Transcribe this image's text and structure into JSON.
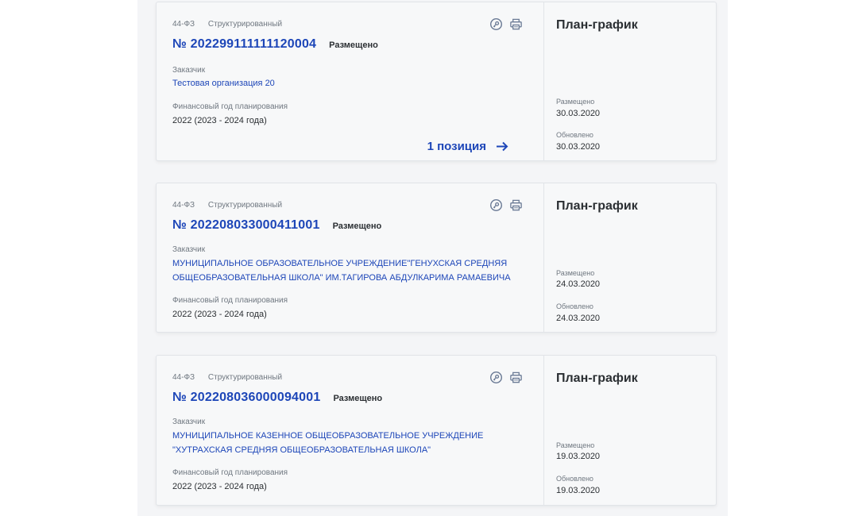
{
  "cards": [
    {
      "law": "44-ФЗ",
      "kind": "Структурированный",
      "number": "№ 202299111111120004",
      "status": "Размещено",
      "customer_label": "Заказчик",
      "customer_line1": "Тестовая организация 20",
      "customer_line2": "",
      "fin_year_label": "Финансовый год планирования",
      "fin_year": "2022 (2023 - 2024 года)",
      "positions_link": "1 позиция",
      "doc_type": "План-график",
      "placed_label": "Размещено",
      "placed_date": "30.03.2020",
      "updated_label": "Обновлено",
      "updated_date": "30.03.2020"
    },
    {
      "law": "44-ФЗ",
      "kind": "Структурированный",
      "number": "№ 202208033000411001",
      "status": "Размещено",
      "customer_label": "Заказчик",
      "customer_line1": "МУНИЦИПАЛЬНОЕ ОБРАЗОВАТЕЛЬНОЕ УЧРЕЖДЕНИЕ\"ГЕНУХСКАЯ СРЕДНЯЯ",
      "customer_line2": "ОБЩЕОБРАЗОВАТЕЛЬНАЯ ШКОЛА\" ИМ.ТАГИРОВА АБДУЛКАРИМА РАМАЕВИЧА",
      "fin_year_label": "Финансовый год планирования",
      "fin_year": "2022 (2023 - 2024 года)",
      "doc_type": "План-график",
      "placed_label": "Размещено",
      "placed_date": "24.03.2020",
      "updated_label": "Обновлено",
      "updated_date": "24.03.2020"
    },
    {
      "law": "44-ФЗ",
      "kind": "Структурированный",
      "number": "№ 202208036000094001",
      "status": "Размещено",
      "customer_label": "Заказчик",
      "customer_line1": "МУНИЦИПАЛЬНОЕ КАЗЕННОЕ ОБЩЕОБРАЗОВАТЕЛЬНОЕ УЧРЕЖДЕНИЕ",
      "customer_line2": "\"ХУТРАХСКАЯ СРЕДНЯЯ ОБЩЕОБРАЗОВАТЕЛЬНАЯ ШКОЛА\"",
      "fin_year_label": "Финансовый год планирования",
      "fin_year": "2022 (2023 - 2024 года)",
      "doc_type": "План-график",
      "placed_label": "Размещено",
      "placed_date": "19.03.2020",
      "updated_label": "Обновлено",
      "updated_date": "19.03.2020"
    }
  ],
  "icons": [
    "signature-icon",
    "print-icon",
    "arrow-right-icon"
  ],
  "colors": {
    "link": "#1d46b8",
    "icon": "#6a7a95"
  }
}
